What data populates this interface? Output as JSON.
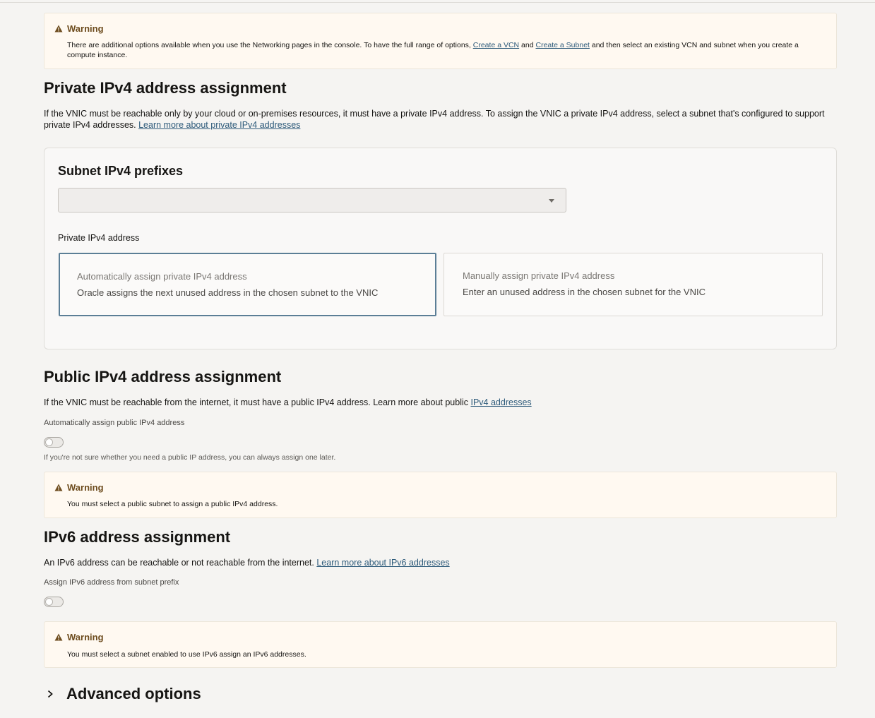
{
  "warning_top": {
    "title": "Warning",
    "text_1": "There are additional options available when you use the Networking pages in the console. To have the full range of options, ",
    "link_vcn": "Create a VCN",
    "text_2": " and ",
    "link_subnet": "Create a Subnet",
    "text_3": " and then select an existing VCN and subnet when you create a compute instance."
  },
  "private": {
    "heading": "Private IPv4 address assignment",
    "desc": "If the VNIC must be reachable only by your cloud or on-premises resources, it must have a private IPv4 address. To assign the VNIC a private IPv4 address, select a subnet that's configured to support private IPv4 addresses. ",
    "learn_link": "Learn more about private IPv4 addresses",
    "card": {
      "title": "Subnet IPv4 prefixes",
      "select_value": "",
      "field_label": "Private IPv4 address",
      "options": [
        {
          "title": "Automatically assign private IPv4 address",
          "desc": "Oracle assigns the next unused address in the chosen subnet to the VNIC",
          "selected": true
        },
        {
          "title": "Manually assign private IPv4 address",
          "desc": "Enter an unused address in the chosen subnet for the VNIC",
          "selected": false
        }
      ]
    }
  },
  "public": {
    "heading": "Public IPv4 address assignment",
    "desc": "If the VNIC must be reachable from the internet, it must have a public IPv4 address. Learn more about public ",
    "learn_link": "IPv4 addresses",
    "toggle_label": "Automatically assign public IPv4 address",
    "toggle_on": false,
    "hint": "If you're not sure whether you need a public IP address, you can always assign one later.",
    "warning_title": "Warning",
    "warning_text": "You must select a public subnet to assign a public IPv4 address."
  },
  "ipv6": {
    "heading": "IPv6 address assignment",
    "desc": "An IPv6 address can be reachable or not reachable from the internet. ",
    "learn_link": "Learn more about IPv6 addresses",
    "toggle_label": "Assign IPv6 address from subnet prefix",
    "toggle_on": false,
    "warning_title": "Warning",
    "warning_text": "You must select a subnet enabled to use IPv6 assign an IPv6 addresses."
  },
  "advanced": {
    "title": "Advanced options",
    "icon": "chevron-right-icon"
  },
  "colors": {
    "warning_bg": "#fff9f1",
    "warning_icon": "#6d4c1e",
    "link": "#2d5a7a",
    "selected_border": "#5b7e96"
  }
}
